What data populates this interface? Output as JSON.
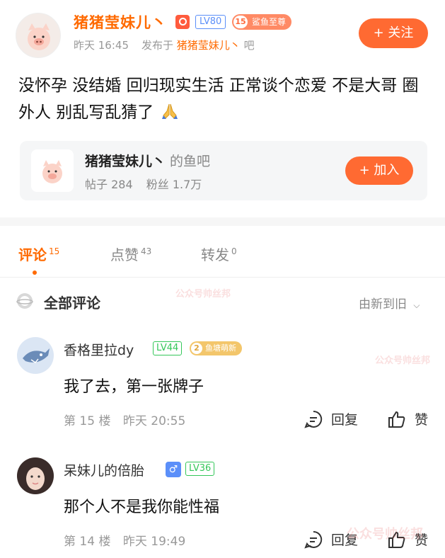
{
  "post": {
    "author": "猪猪莹妹儿丶",
    "level_badge": "LV80",
    "fan_badge_level": "15",
    "fan_badge_text": "鲨鱼至尊",
    "time": "昨天 16:45",
    "published_in_label": "发布于",
    "published_in_bar": "猪猪莹妹儿丶",
    "published_in_suffix": "吧",
    "follow_label": "+ 关注",
    "content": "没怀孕 没结婚 回归现实生活 正常谈个恋爱 不是大哥 圈外人 别乱写乱猜了"
  },
  "forum": {
    "name": "猪猪莹妹儿丶",
    "suffix": "的鱼吧",
    "posts_label": "帖子 284",
    "fans_label": "粉丝 1.7万",
    "join_label": "+ 加入"
  },
  "tabs": [
    {
      "label": "评论",
      "count": "15"
    },
    {
      "label": "点赞",
      "count": "43"
    },
    {
      "label": "转发",
      "count": "0"
    }
  ],
  "comments_header": {
    "title": "全部评论",
    "sort": "由新到旧"
  },
  "comments": [
    {
      "user": "香格里拉dy",
      "level": "LV44",
      "fan_level": "2",
      "fan_text": "鱼塘萌新",
      "text": "我了去，第一张牌子",
      "floor": "第 15 楼",
      "time": "昨天 20:55",
      "reply": "回复",
      "like": "赞"
    },
    {
      "user": "呆妹儿的倍胎",
      "gender": "♂",
      "level": "LV36",
      "text": "那个人不是我你能性福",
      "floor": "第 14 楼",
      "time": "昨天 19:49",
      "reply": "回复",
      "like": "赞"
    }
  ],
  "watermarks": [
    "公众号帅丝邦",
    "公众号帅丝邦",
    "公众号帅丝邦"
  ],
  "colors": {
    "accent": "#ff6a00",
    "button": "#ff6a32",
    "lv_blue": "#5b8ff9",
    "lv_green": "#34c759"
  }
}
